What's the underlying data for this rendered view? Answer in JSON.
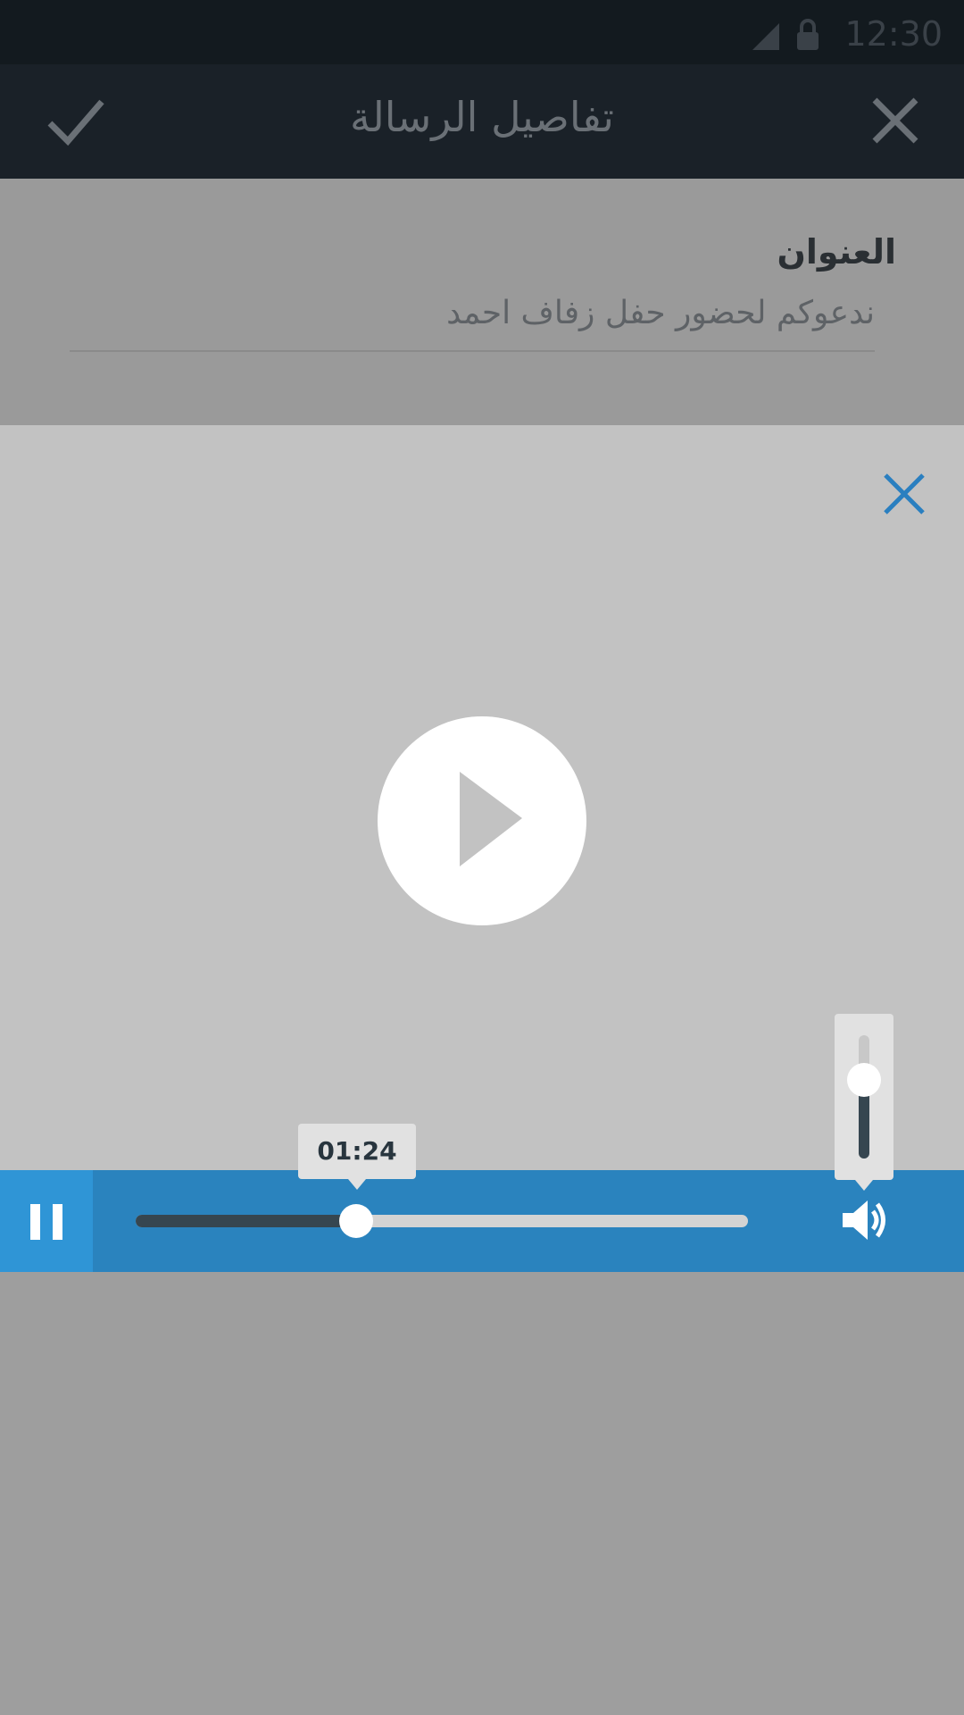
{
  "status_bar": {
    "time": "12:30",
    "icons": [
      "signal-icon",
      "lock-icon"
    ]
  },
  "app_bar": {
    "title": "تفاصيل الرسالة",
    "confirm_icon": "check-icon",
    "close_icon": "close-icon"
  },
  "form": {
    "title_label": "العنوان",
    "title_value": "ندعوكم لحضور حفل زفاف احمد"
  },
  "player": {
    "close_icon": "close-icon",
    "play_icon": "play-icon",
    "pause_icon": "pause-icon",
    "volume_icon": "volume-icon",
    "current_time": "01:24",
    "progress": 0.36,
    "volume": 0.64
  },
  "colors": {
    "control_bar": "#2a83be",
    "pause_bg": "#2f95d6",
    "track_fill": "#364650",
    "accent": "#2a7fc0"
  }
}
